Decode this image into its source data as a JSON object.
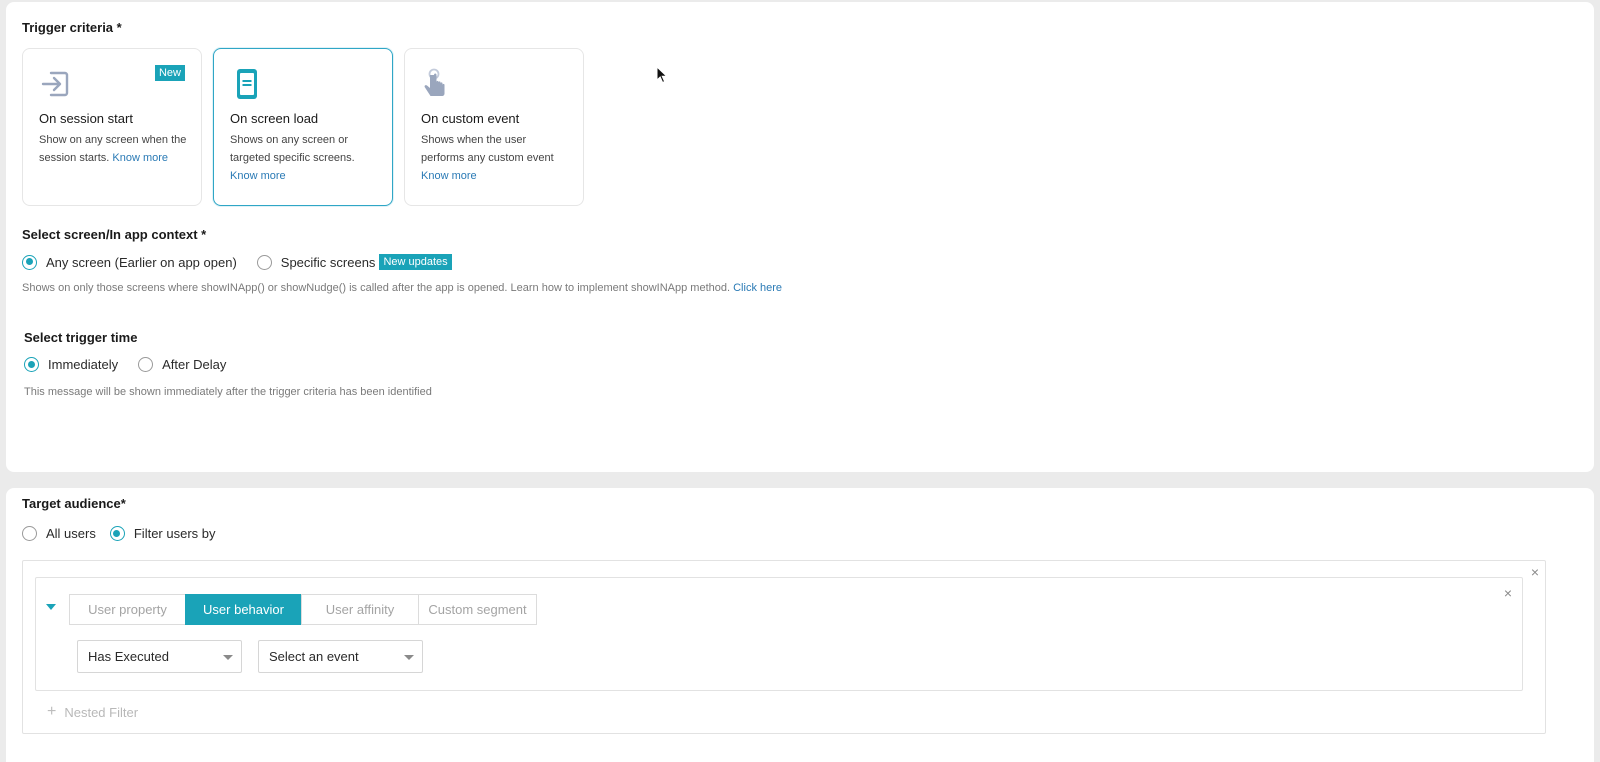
{
  "trigger": {
    "title": "Trigger criteria *",
    "cards": [
      {
        "title": "On session start",
        "desc": "Show on any screen when the session starts.",
        "link": "Know more",
        "badge": "New",
        "icon": "enter-icon",
        "selected": false
      },
      {
        "title": "On screen load",
        "desc": "Shows on any screen or targeted specific screens.",
        "link": "Know more",
        "icon": "mobile-screen-icon",
        "selected": true
      },
      {
        "title": "On custom event",
        "desc": "Shows when the user performs any custom event",
        "link": "Know more",
        "icon": "tap-hand-icon",
        "selected": false
      }
    ]
  },
  "screen_context": {
    "title": "Select screen/In app context *",
    "options": [
      "Any screen (Earlier on app open)",
      "Specific screens"
    ],
    "selected": "Any screen (Earlier on app open)",
    "badge": "New updates",
    "hint": "Shows on only those screens where showINApp() or showNudge() is called after the app is opened. Learn how to implement showINApp method.",
    "hint_link": "Click here"
  },
  "trigger_time": {
    "title": "Select trigger time",
    "options": [
      "Immediately",
      "After Delay"
    ],
    "selected": "Immediately",
    "hint": "This message will be shown immediately after the trigger criteria has been identified"
  },
  "audience": {
    "title": "Target audience*",
    "options": [
      "All users",
      "Filter users by"
    ],
    "selected": "Filter users by",
    "tabs": [
      "User property",
      "User behavior",
      "User affinity",
      "Custom segment"
    ],
    "active_tab": "User behavior",
    "condition_select": "Has Executed",
    "event_select": "Select an event",
    "nested_filter": "Nested Filter",
    "close_symbol": "×",
    "plus_symbol": "+"
  },
  "colors": {
    "accent": "#1aa3b8",
    "link": "#2a7ab5",
    "selected_border": "#2fa6c6"
  }
}
